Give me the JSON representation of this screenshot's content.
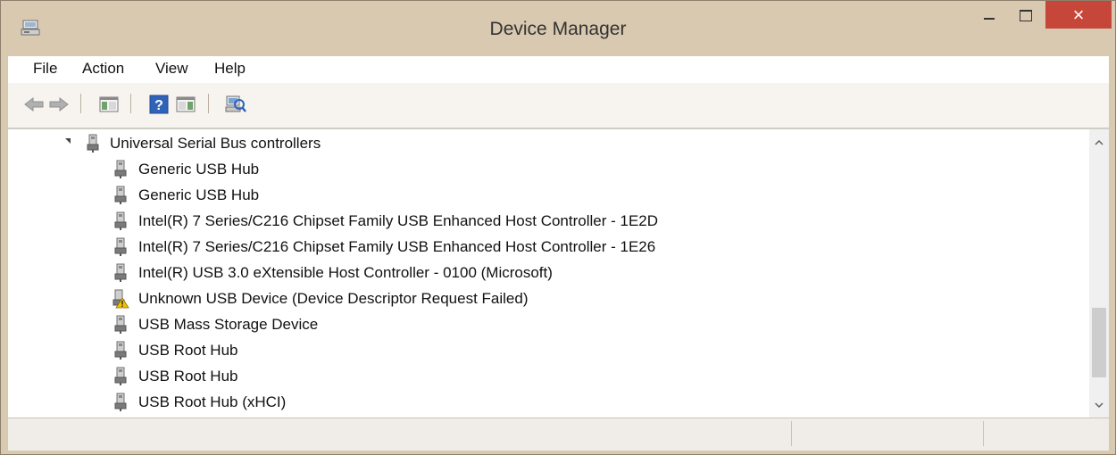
{
  "window": {
    "title": "Device Manager",
    "close_glyph": "×",
    "min_glyph": "–"
  },
  "menu": [
    "File",
    "Action",
    "View",
    "Help"
  ],
  "toolbar": {
    "buttons": [
      "back-icon",
      "forward-icon",
      "show-hide-console-tree-icon",
      "help-icon",
      "show-hide-action-pane-icon",
      "scan-hardware-icon"
    ]
  },
  "tree": {
    "category": "Universal Serial Bus controllers",
    "devices": [
      {
        "label": "Generic USB Hub",
        "icon": "usb-device-icon"
      },
      {
        "label": "Generic USB Hub",
        "icon": "usb-device-icon"
      },
      {
        "label": "Intel(R) 7 Series/C216 Chipset Family USB Enhanced Host Controller - 1E2D",
        "icon": "usb-device-icon"
      },
      {
        "label": "Intel(R) 7 Series/C216 Chipset Family USB Enhanced Host Controller - 1E26",
        "icon": "usb-device-icon"
      },
      {
        "label": "Intel(R) USB 3.0 eXtensible Host Controller - 0100 (Microsoft)",
        "icon": "usb-device-icon"
      },
      {
        "label": "Unknown USB Device (Device Descriptor Request Failed)",
        "icon": "warning-device-icon"
      },
      {
        "label": "USB Mass Storage Device",
        "icon": "usb-device-icon"
      },
      {
        "label": "USB Root Hub",
        "icon": "usb-device-icon"
      },
      {
        "label": "USB Root Hub",
        "icon": "usb-device-icon"
      },
      {
        "label": "USB Root Hub (xHCI)",
        "icon": "usb-device-icon"
      }
    ]
  },
  "colors": {
    "frame": "#d9c9b0",
    "close_button": "#c6463a",
    "warning": "#f2c200"
  }
}
